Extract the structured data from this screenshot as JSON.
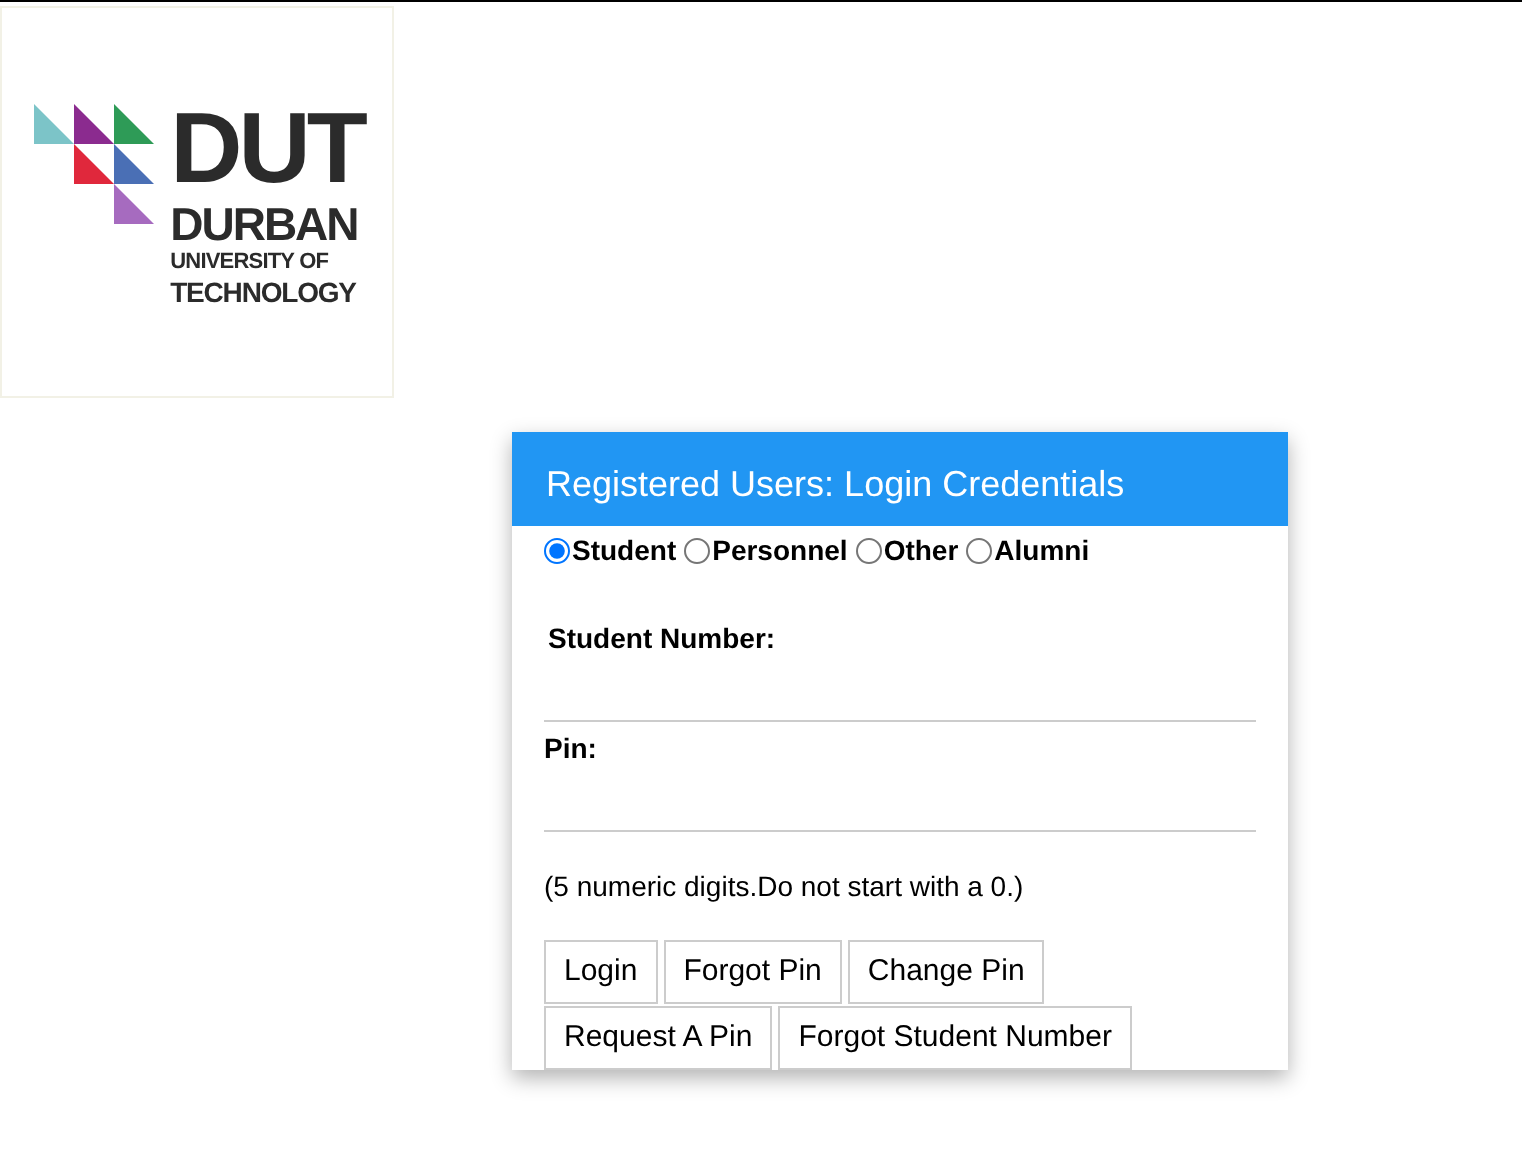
{
  "logo": {
    "lines": [
      "DUT",
      "DURBAN",
      "UNIVERSITY OF",
      "TECHNOLOGY"
    ]
  },
  "login": {
    "title": "Registered Users: Login Credentials",
    "user_types": [
      {
        "label": "Student",
        "selected": true
      },
      {
        "label": "Personnel",
        "selected": false
      },
      {
        "label": "Other",
        "selected": false
      },
      {
        "label": "Alumni",
        "selected": false
      }
    ],
    "fields": [
      {
        "label": "Student Number:"
      },
      {
        "label": "Pin:"
      }
    ],
    "hint": "(5 numeric digits.Do not start with a 0.)",
    "button_rows": [
      [
        "Login",
        "Forgot Pin",
        "Change Pin"
      ],
      [
        "Request A Pin",
        "Forgot Student Number"
      ]
    ]
  }
}
